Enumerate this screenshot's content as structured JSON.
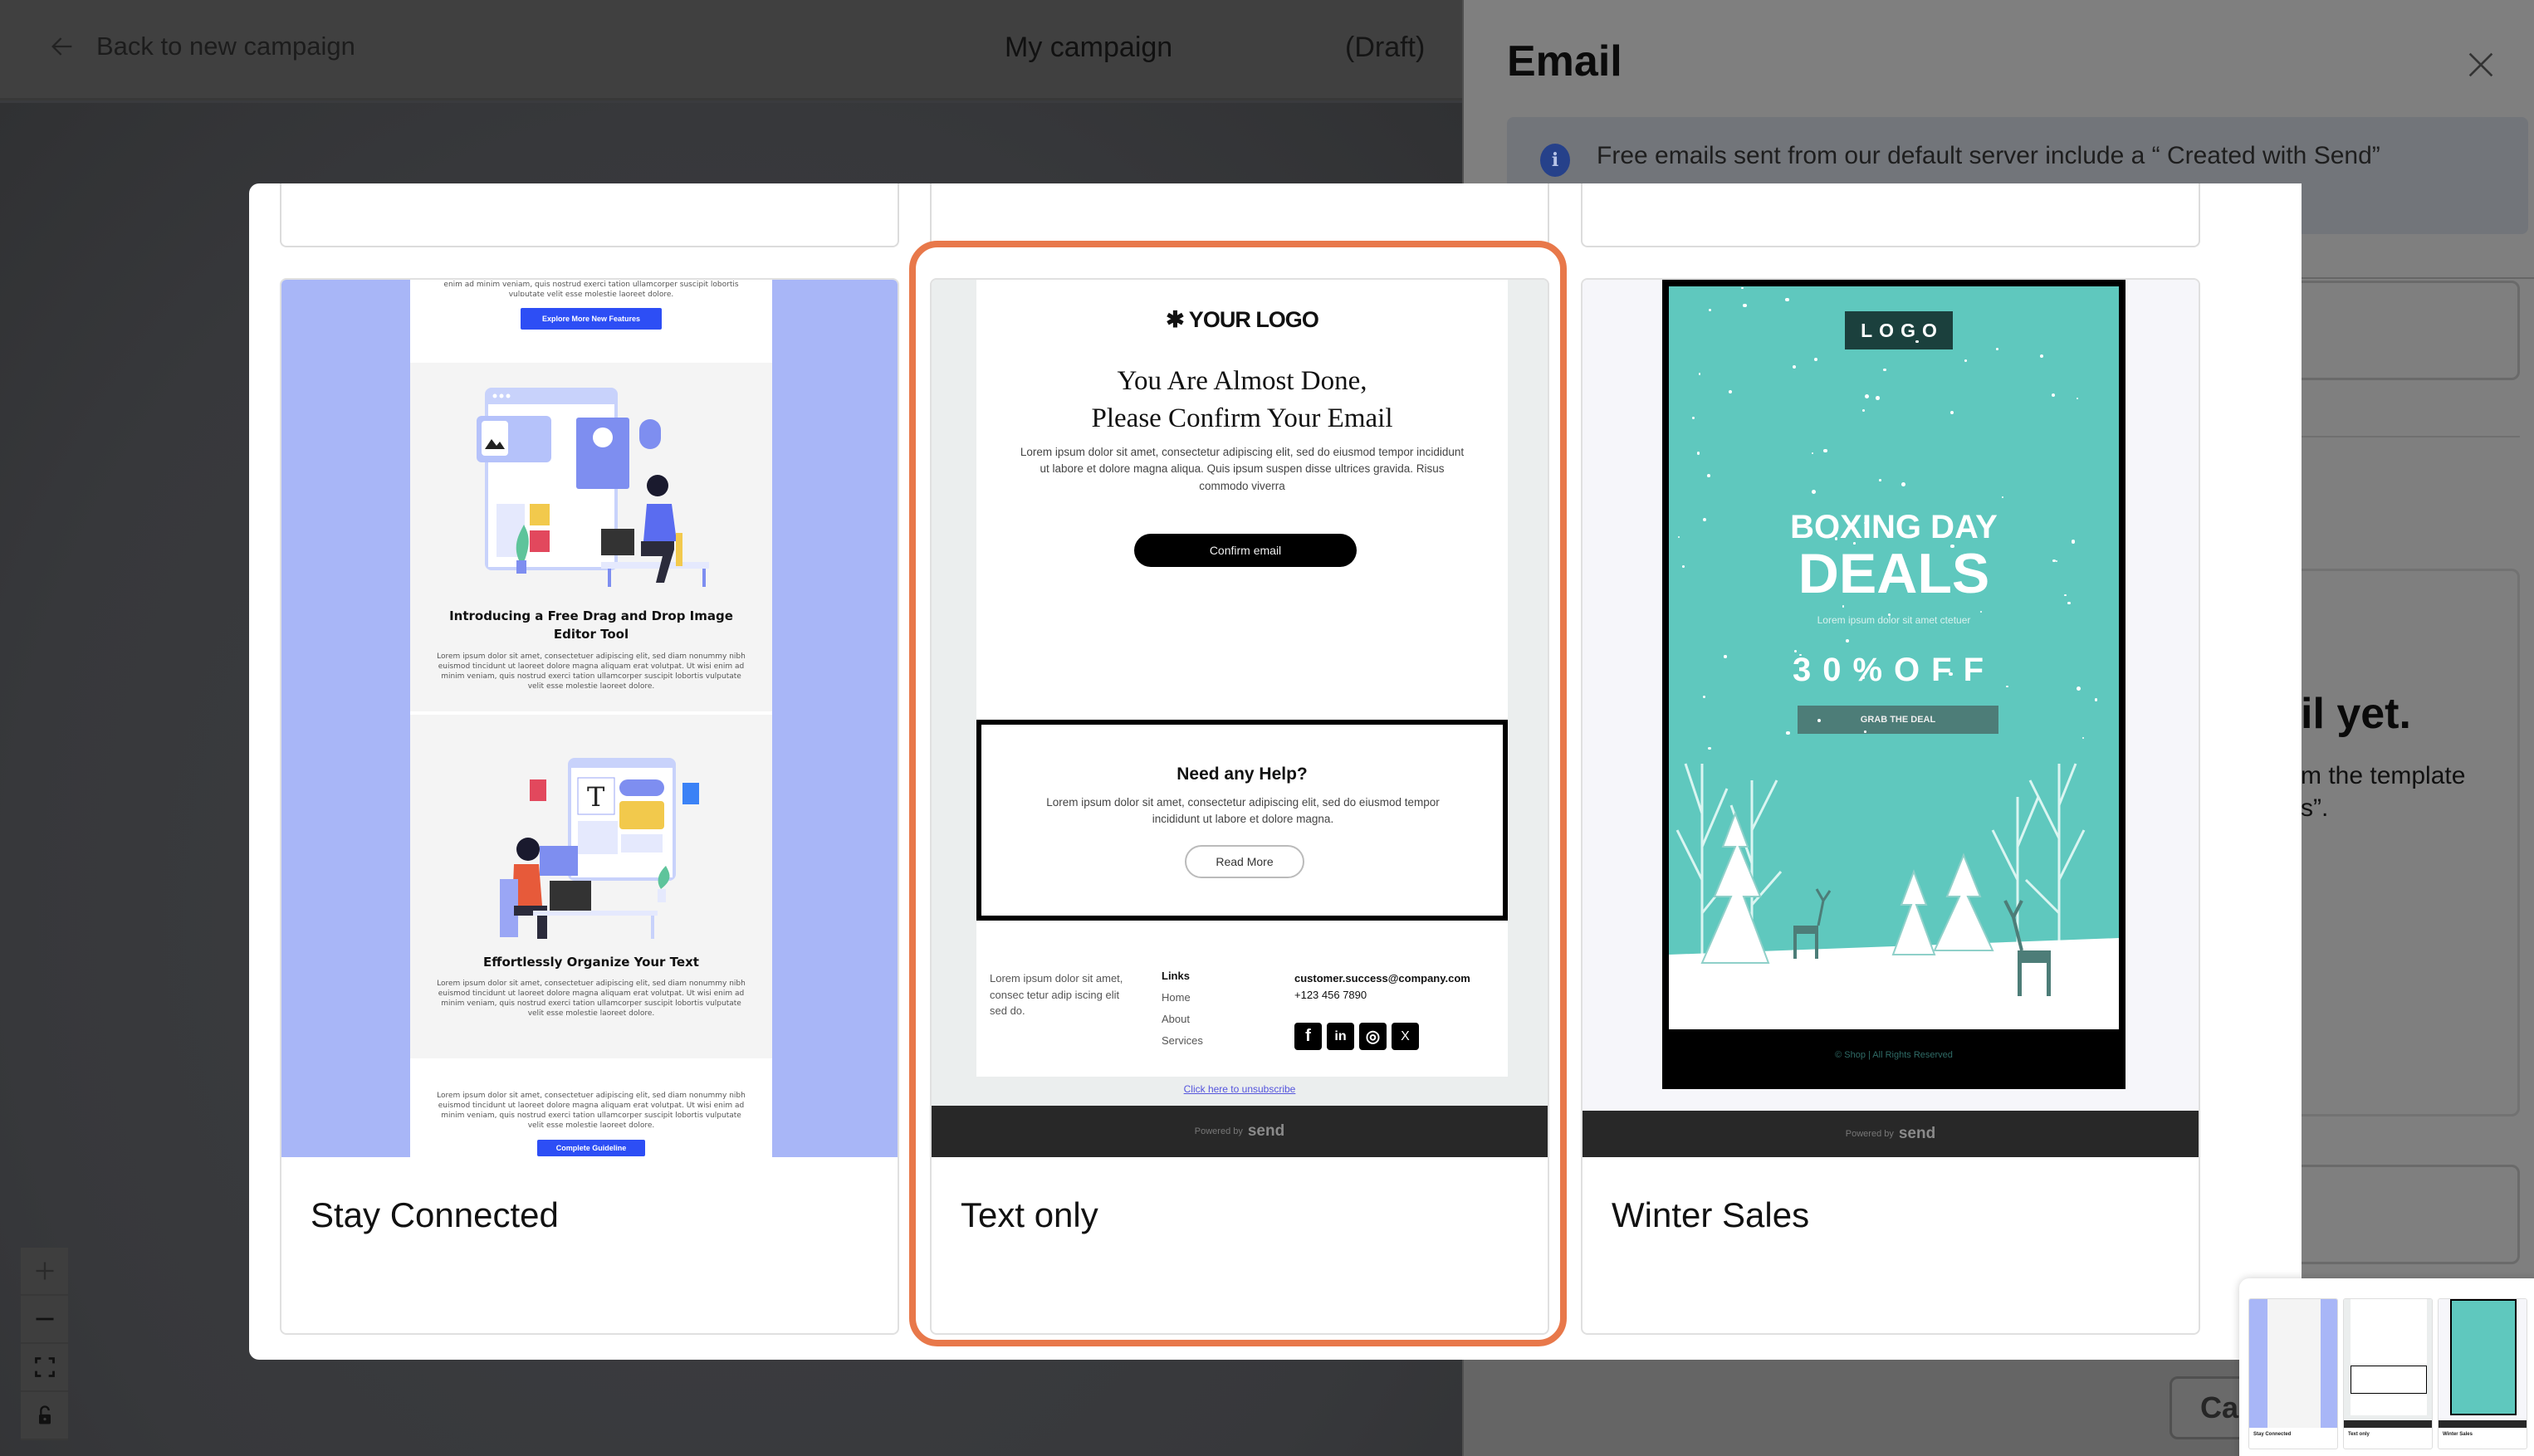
{
  "topbar": {
    "back_label": "Back to new campaign",
    "campaign_title": "My campaign",
    "campaign_status": "(Draft)"
  },
  "zoom_controls": {
    "zoom_in_icon": "plus-icon",
    "zoom_out_icon": "minus-icon",
    "fit_icon": "fit-view-icon",
    "lock_icon": "unlock-icon"
  },
  "side_panel": {
    "title": "Email",
    "info_text": "Free emails sent from our default server include a “ Created with Send”",
    "empty_title_fragment": "il yet.",
    "empty_desc_line1": "m the template",
    "empty_desc_line2": "s”.",
    "cancel_label": "Car"
  },
  "modal": {
    "selected_index": 1,
    "highlight_color": "#e8784a",
    "templates": [
      {
        "label": "Stay Connected",
        "preview": {
          "top_text": "enim ad minim veniam, quis nostrud exerci tation ullamcorper suscipit lobortis vulputate velit esse molestie laoreet dolore.",
          "button1": "Explore More New Features",
          "heading1": "Introducing a Free Drag and Drop Image Editor Tool",
          "body1": "Lorem ipsum dolor sit amet, consectetuer adipiscing elit, sed diam nonummy nibh euismod tincidunt ut laoreet dolore magna aliquam erat volutpat. Ut wisi enim ad minim veniam, quis nostrud exerci tation ullamcorper suscipit lobortis vulputate velit esse molestie laoreet dolore.",
          "heading2": "Effortlessly Organize Your Text",
          "body2": "Lorem ipsum dolor sit amet, consectetuer adipiscing elit, sed diam nonummy nibh euismod tincidunt ut laoreet dolore magna aliquam erat volutpat. Ut wisi enim ad minim veniam, quis nostrud exerci tation ullamcorper suscipit lobortis vulputate velit esse molestie laoreet dolore.",
          "body3": "Lorem ipsum dolor sit amet, consectetuer adipiscing elit, sed diam nonummy nibh euismod tincidunt ut laoreet dolore magna aliquam erat volutpat. Ut wisi enim ad minim veniam, quis nostrud exerci tation ullamcorper suscipit lobortis vulputate velit esse molestie laoreet dolore.",
          "button2": "Complete Guideline",
          "accent": "#2d4ef5",
          "background": "#a8b6f7"
        }
      },
      {
        "label": "Text only",
        "preview": {
          "logo": "✱ YOUR LOGO",
          "heading": "You Are Almost Done, Please Confirm Your Email",
          "body": "Lorem ipsum dolor sit amet, consectetur adipiscing elit, sed do eiusmod tempor incididunt ut labore et dolore magna aliqua. Quis ipsum suspen disse ultrices gravida. Risus commodo viverra",
          "confirm_button": "Confirm email",
          "help_heading": "Need any Help?",
          "help_body": "Lorem ipsum dolor sit amet, consectetur adipiscing elit, sed do eiusmod tempor incididunt ut labore et dolore magna.",
          "read_more": "Read More",
          "footer_text": "Lorem ipsum dolor sit amet, consec tetur adip iscing elit sed do.",
          "links_heading": "Links",
          "links": [
            "Home",
            "About",
            "Services"
          ],
          "email": "customer.success@company.com",
          "phone": "+123 456 7890",
          "social": [
            "f",
            "in",
            "◎",
            "X"
          ],
          "unsubscribe": "Click here to unsubscribe",
          "powered_by": "Powered by",
          "brand": "send"
        }
      },
      {
        "label": "Winter Sales",
        "preview": {
          "logo": "LOGO",
          "headline1": "BOXING DAY",
          "headline2": "DEALS",
          "subtext": "Lorem ipsum dolor sit amet ctetuer",
          "offer": "30%OFF",
          "button": "GRAB THE DEAL",
          "copyright": "© Shop | All Rights Reserved",
          "powered_by": "Powered by",
          "brand": "send",
          "teal": "#5fc8be"
        }
      }
    ]
  }
}
